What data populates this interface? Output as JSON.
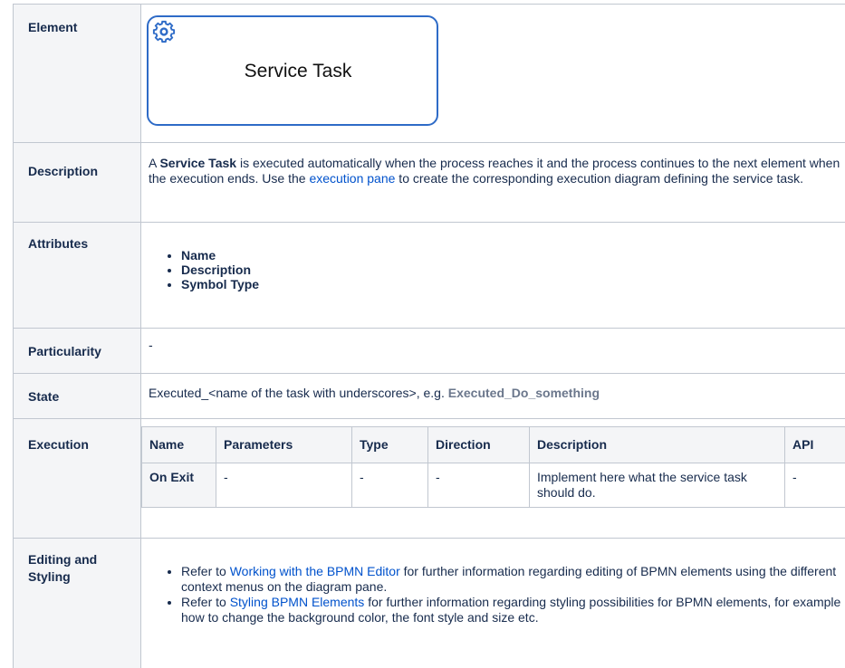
{
  "element": {
    "header": "Element",
    "diagram_label": "Service Task"
  },
  "description": {
    "header": "Description",
    "p1": "A ",
    "bold": "Service Task",
    "p2": " is executed automatically when the process reaches it and the process continues to the next element when the execution ends. Use the ",
    "link": "execution pane",
    "p3": " to create the corresponding execution diagram defining the service task."
  },
  "attributes": {
    "header": "Attributes",
    "items": [
      "Name",
      "Description",
      "Symbol Type"
    ]
  },
  "particularity": {
    "header": "Particularity",
    "value": "-"
  },
  "state": {
    "header": "State",
    "text": "Executed_<name of the task with underscores>, e.g. ",
    "example": "Executed_Do_something"
  },
  "execution": {
    "header": "Execution",
    "columns": [
      "Name",
      "Parameters",
      "Type",
      "Direction",
      "Description",
      "API"
    ],
    "row": [
      "On Exit",
      "-",
      "-",
      "-",
      "Implement here what the service task should do.",
      "-"
    ]
  },
  "editing": {
    "header": "Editing and Styling",
    "item1": {
      "pre": "Refer to ",
      "link": "Working with the BPMN Editor",
      "post": " for further information regarding editing of BPMN elements using the different context menus on the diagram pane."
    },
    "item2": {
      "pre": "Refer to ",
      "link": "Styling BPMN Elements",
      "post": " for further information regarding styling possibilities for BPMN elements, for example how to change the background color, the font style and size etc."
    }
  },
  "colors": {
    "link": "#0052cc",
    "header_bg": "#f4f5f7",
    "border": "#c1c7d0",
    "bpmn_border": "#2e6bc7"
  },
  "icons": [
    "gear-icon"
  ]
}
